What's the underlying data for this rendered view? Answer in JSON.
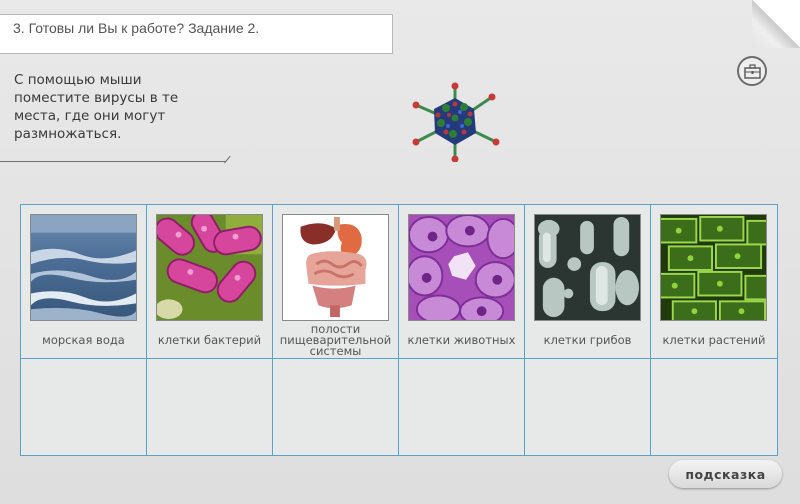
{
  "header": {
    "title": "3. Готовы ли Вы к работе? Задание 2."
  },
  "instruction": {
    "lines": [
      "С помощью мыши",
      "поместите вирусы в те",
      "места, где они могут",
      "размножаться."
    ]
  },
  "draggable": {
    "icon": "virus-icon"
  },
  "toolbar": {
    "icon": "briefcase-icon"
  },
  "targets": [
    {
      "label": "морская вода",
      "image": "sea-water-image"
    },
    {
      "label": "клетки бактерий",
      "image": "bacteria-image"
    },
    {
      "label_lines": [
        "полости",
        "пищеварительной",
        "системы"
      ],
      "image": "digestive-system-image"
    },
    {
      "label": "клетки животных",
      "image": "animal-cells-image"
    },
    {
      "label": "клетки грибов",
      "image": "fungi-cells-image"
    },
    {
      "label": "клетки растений",
      "image": "plant-cells-image"
    }
  ],
  "hint_button": {
    "label": "подсказка"
  },
  "colors": {
    "grid_border": "#5aa2c7",
    "background": "#e4e4e4"
  }
}
